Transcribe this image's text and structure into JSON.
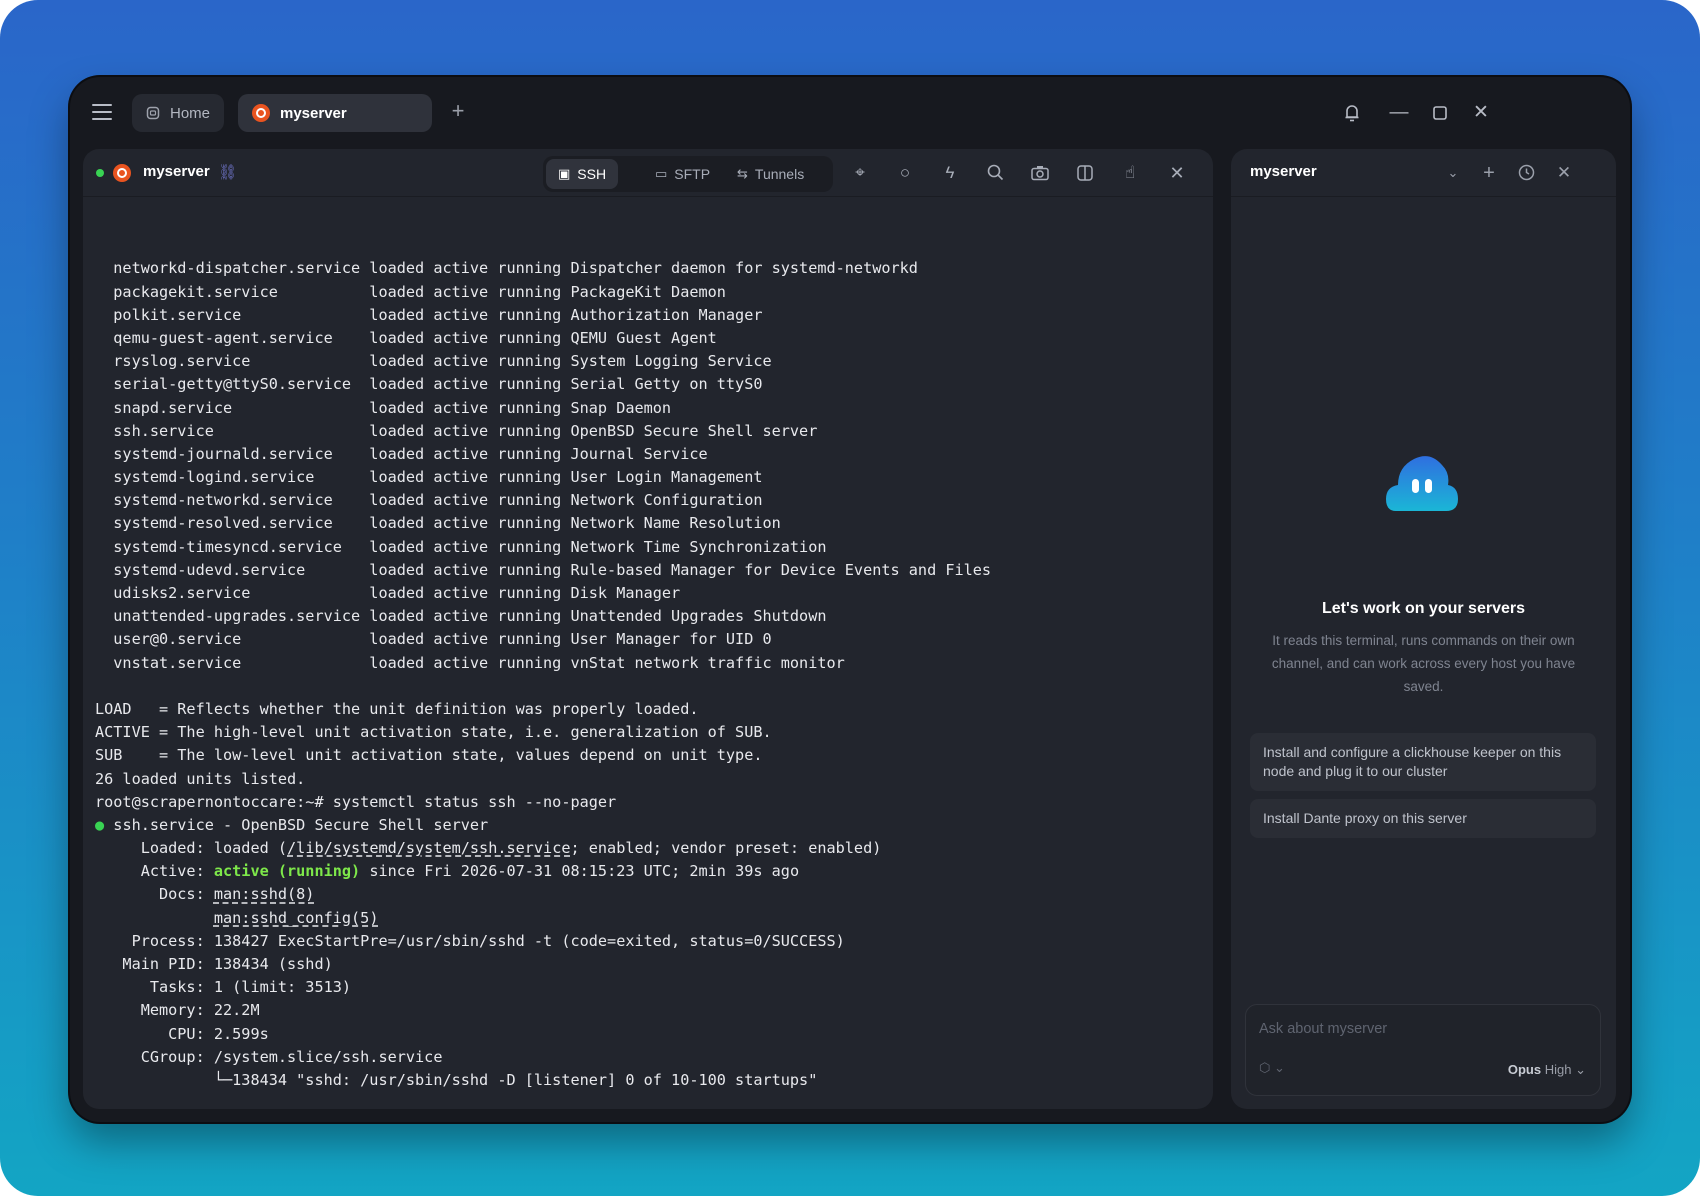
{
  "titlebar": {
    "tabs": [
      {
        "label": "Home",
        "icon": "home-icon"
      },
      {
        "label": "myserver",
        "icon": "ubuntu-icon",
        "active": true
      }
    ],
    "add_tab_icon": "plus-icon",
    "controls": [
      "bell-icon",
      "minimize-icon",
      "maximize-icon",
      "close-icon"
    ]
  },
  "terminal": {
    "status_color": "#39d353",
    "server_name": "myserver",
    "modes": [
      {
        "label": "SSH",
        "icon": "terminal-icon",
        "active": true
      },
      {
        "label": "SFTP",
        "icon": "folder-icon"
      },
      {
        "label": "Tunnels",
        "icon": "arrows-icon"
      }
    ],
    "tools": [
      "broadcast-icon",
      "record-icon",
      "snippets-icon",
      "search-icon",
      "camera-icon",
      "split-icon",
      "gesture-icon",
      "close-icon"
    ],
    "lines": [
      "  networkd-dispatcher.service loaded active running Dispatcher daemon for systemd-networkd",
      "  packagekit.service          loaded active running PackageKit Daemon",
      "  polkit.service              loaded active running Authorization Manager",
      "  qemu-guest-agent.service    loaded active running QEMU Guest Agent",
      "  rsyslog.service             loaded active running System Logging Service",
      "  serial-getty@ttyS0.service  loaded active running Serial Getty on ttyS0",
      "  snapd.service               loaded active running Snap Daemon",
      "  ssh.service                 loaded active running OpenBSD Secure Shell server",
      "  systemd-journald.service    loaded active running Journal Service",
      "  systemd-logind.service      loaded active running User Login Management",
      "  systemd-networkd.service    loaded active running Network Configuration",
      "  systemd-resolved.service    loaded active running Network Name Resolution",
      "  systemd-timesyncd.service   loaded active running Network Time Synchronization",
      "  systemd-udevd.service       loaded active running Rule-based Manager for Device Events and Files",
      "  udisks2.service             loaded active running Disk Manager",
      "  unattended-upgrades.service loaded active running Unattended Upgrades Shutdown",
      "  user@0.service              loaded active running User Manager for UID 0",
      "  vnstat.service              loaded active running vnStat network traffic monitor",
      "",
      "LOAD   = Reflects whether the unit definition was properly loaded.",
      "ACTIVE = The high-level unit activation state, i.e. generalization of SUB.",
      "SUB    = The low-level unit activation state, values depend on unit type.",
      "26 loaded units listed.",
      "root@scrapernontoccare:~# systemctl status ssh --no-pager"
    ],
    "status": {
      "bullet": "●",
      "service_line": " ssh.service - OpenBSD Secure Shell server",
      "loaded_prefix": "     Loaded: loaded (",
      "loaded_path": "/lib/systemd/system/ssh.service",
      "loaded_suffix": "; enabled; vendor preset: enabled)",
      "active_prefix": "     Active: ",
      "active_state": "active (running)",
      "active_suffix": " since Fri 2026-07-31 08:15:23 UTC; 2min 39s ago",
      "docs_prefix": "       Docs: ",
      "doc1": "man:sshd(8)",
      "doc2_indent": "             ",
      "doc2": "man:sshd_config(5)",
      "rest": [
        "    Process: 138427 ExecStartPre=/usr/sbin/sshd -t (code=exited, status=0/SUCCESS)",
        "   Main PID: 138434 (sshd)",
        "      Tasks: 1 (limit: 3513)",
        "     Memory: 22.2M",
        "        CPU: 2.599s",
        "     CGroup: /system.slice/ssh.service",
        "             └─138434 \"sshd: /usr/sbin/sshd -D [listener] 0 of 10-100 startups\""
      ]
    }
  },
  "assistant": {
    "title": "myserver",
    "icons": [
      "chevron-down-icon",
      "plus-icon",
      "history-icon",
      "close-icon"
    ],
    "heading": "Let's work on your servers",
    "description": "It reads this terminal, runs commands on their own channel, and can work across every host you have saved.",
    "suggestions": [
      "Install and configure a clickhouse keeper on this node and plug it to our cluster",
      "Install Dante proxy on this server"
    ],
    "input_placeholder": "Ask about myserver",
    "model_name": "Opus",
    "model_effort": "High",
    "accent": "#29a3e6"
  }
}
